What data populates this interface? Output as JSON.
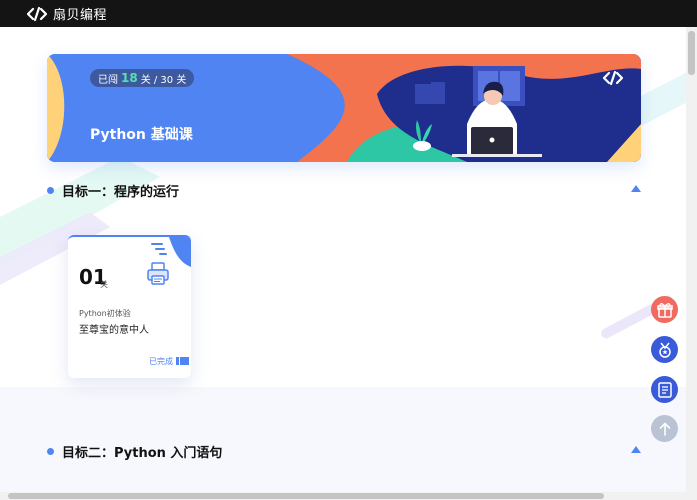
{
  "app": {
    "brand_name": "扇贝编程"
  },
  "banner": {
    "progress_prefix": "已闯",
    "progress_current": "18",
    "progress_suffix": "关 / 30 关",
    "title": "Python 基础课"
  },
  "sections": [
    {
      "title": "目标一：程序的运行",
      "levels": [
        {
          "number": "01",
          "unit": "关",
          "subtitle": "Python初体验",
          "name": "至尊宝的意中人",
          "status": "已完成",
          "icon": "printer-icon"
        }
      ]
    },
    {
      "title": "目标二：Python 入门语句",
      "levels": []
    }
  ],
  "floating_buttons": [
    {
      "icon": "gift-icon"
    },
    {
      "icon": "medal-icon"
    },
    {
      "icon": "book-icon"
    },
    {
      "icon": "arrow-up-icon"
    }
  ],
  "colors": {
    "accent": "#4f84f2",
    "topbar": "#141414",
    "coral": "#f06a5f",
    "teal": "#2ec7a5",
    "navy": "#1f2e8c",
    "progress_highlight": "#58e0b0"
  }
}
